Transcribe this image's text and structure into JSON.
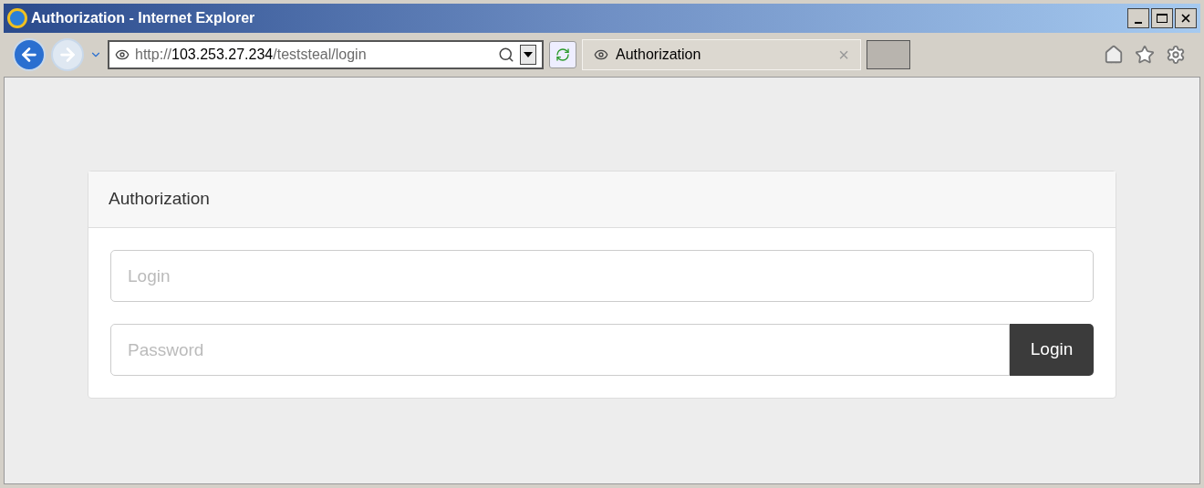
{
  "window": {
    "title": "Authorization - Internet Explorer"
  },
  "address_bar": {
    "url_parts": [
      {
        "text": "http://",
        "emphasis": false
      },
      {
        "text": "103.253.27.234",
        "emphasis": true
      },
      {
        "text": "/teststeal/login",
        "emphasis": false
      }
    ]
  },
  "tabs": [
    {
      "label": "Authorization",
      "selected": true,
      "close": "×"
    }
  ],
  "panel": {
    "title": "Authorization",
    "fields": [
      {
        "placeholder": "Login",
        "kind": "text"
      },
      {
        "placeholder": "Password",
        "kind": "password",
        "button": "Login"
      }
    ]
  }
}
